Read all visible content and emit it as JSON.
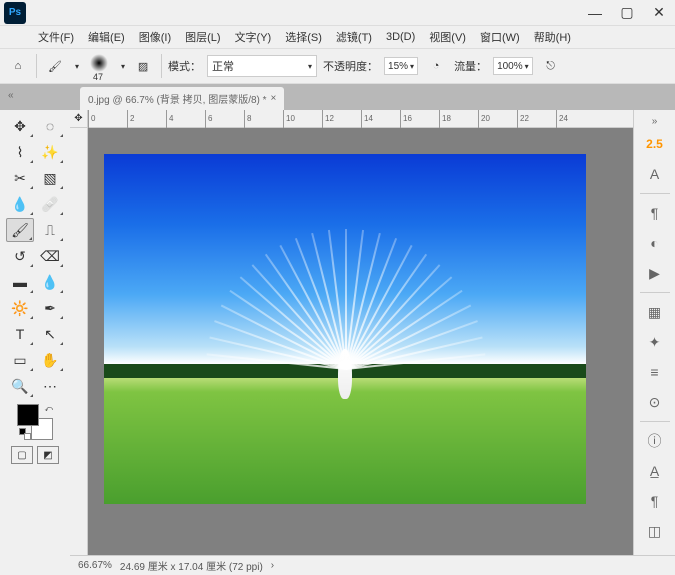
{
  "menu": {
    "file": "文件(F)",
    "edit": "编辑(E)",
    "image": "图像(I)",
    "layer": "图层(L)",
    "type": "文字(Y)",
    "select": "选择(S)",
    "filter": "滤镜(T)",
    "threeD": "3D(D)",
    "view": "视图(V)",
    "window": "窗口(W)",
    "help": "帮助(H)"
  },
  "options": {
    "brush_size": "47",
    "mode_label": "模式：",
    "mode_value": "正常",
    "opacity_label": "不透明度：",
    "opacity_value": "15%",
    "flow_label": "流量：",
    "flow_value": "100%"
  },
  "tab": {
    "title": "0.jpg @ 66.7% (背景 拷贝, 图层蒙版/8) *"
  },
  "ruler": [
    "0",
    "2",
    "4",
    "6",
    "8",
    "10",
    "12",
    "14",
    "16",
    "18",
    "20",
    "22",
    "24"
  ],
  "panel": {
    "id": "2.5",
    "a": "A"
  },
  "status": {
    "zoom": "66.67%",
    "dims": "24.69 厘米 x 17.04 厘米 (72 ppi)"
  }
}
